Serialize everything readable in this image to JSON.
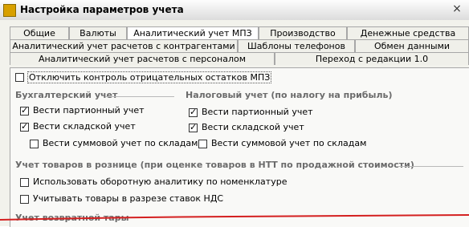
{
  "window": {
    "title": "Настройка параметров учета",
    "close_glyph": "×"
  },
  "tabs": {
    "row1": [
      "Общие",
      "Валюты",
      "Аналитический учет МПЗ",
      "Производство",
      "Денежные средства"
    ],
    "row2": [
      "Аналитический учет расчетов с контрагентами",
      "Шаблоны телефонов",
      "Обмен данными"
    ],
    "row3": [
      "Аналитический учет расчетов с персоналом",
      "Переход с редакции 1.0"
    ],
    "active": "Аналитический учет МПЗ"
  },
  "options": {
    "disable_negative_check": {
      "label": "Отключить контроль отрицательных остатков МПЗ",
      "checked": false
    }
  },
  "accounting": {
    "title": "Бухгалтерский учет",
    "batch": {
      "label": "Вести партионный учет",
      "checked": true
    },
    "warehouse": {
      "label": "Вести складской учет",
      "checked": true
    },
    "sum_by_warehouse": {
      "label": "Вести суммовой учет по складам",
      "checked": false
    }
  },
  "tax": {
    "title": "Налоговый учет (по налогу на прибыль)",
    "batch": {
      "label": "Вести партионный учет",
      "checked": true
    },
    "warehouse": {
      "label": "Вести складской учет",
      "checked": true
    },
    "sum_by_warehouse": {
      "label": "Вести суммовой учет по складам",
      "checked": false
    }
  },
  "retail": {
    "title": "Учет товаров в рознице (при оценке товаров в НТТ по продажной стоимости)",
    "turnover": {
      "label": "Использовать оборотную аналитику по номенклатуре",
      "checked": false
    },
    "vat_rates": {
      "label": "Учитывать товары в разрезе ставок НДС",
      "checked": false
    }
  },
  "returnable": {
    "title": "Учет возвратной тары"
  },
  "colors": {
    "annotation_line": "#d42020"
  }
}
